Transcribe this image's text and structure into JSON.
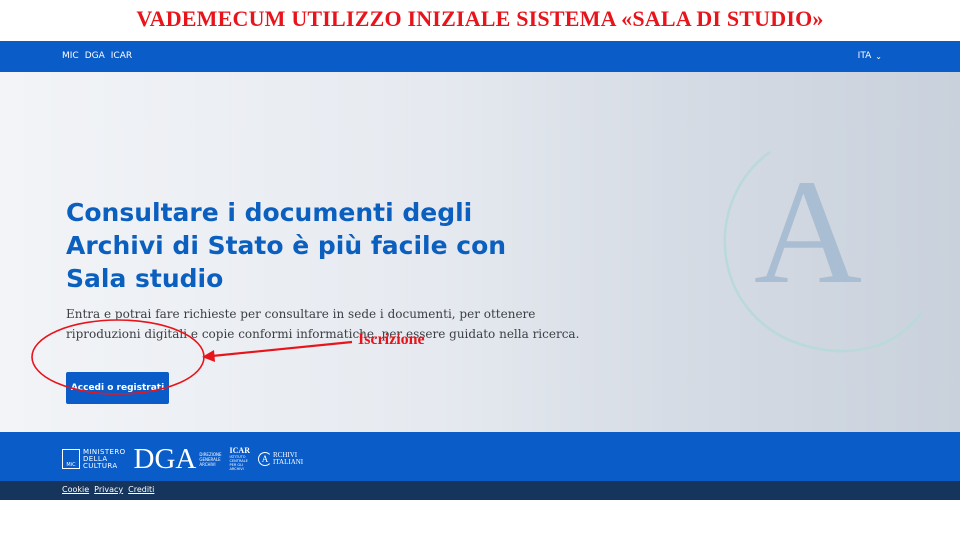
{
  "slide": {
    "title": "VADEMECUM UTILIZZO INIZIALE SISTEMA «SALA DI STUDIO»",
    "annotation_label": "Iscrizione"
  },
  "topbar": {
    "links": [
      "MIC",
      "DGA",
      "ICAR"
    ],
    "language": "ITA"
  },
  "hero": {
    "title": "Consultare i documenti degli Archivi di Stato è più facile con Sala studio",
    "description": "Entra e potrai fare richieste per consultare in sede i documenti, per ottenere riproduzioni digitali e copie conformi informatiche, per essere guidato nella ricerca.",
    "cta_label": "Accedi o registrati",
    "emblem_letter": "A"
  },
  "footer": {
    "mic": [
      "MINISTERO",
      "DELLA",
      "CULTURA"
    ],
    "mic_mark": "MiC",
    "dga": "DGA",
    "dga_sub": [
      "DIREZIONE",
      "GENERALE",
      "ARCHIVI"
    ],
    "icar": "ICAR",
    "icar_sub": [
      "ISTITUTO",
      "CENTRALE",
      "PER GLI",
      "ARCHIVI"
    ],
    "archivi": [
      "RCHIVI",
      "ITALIANI"
    ],
    "archivi_letter": "A",
    "links": [
      "Cookie",
      "Privacy",
      "Crediti"
    ]
  },
  "colors": {
    "brand_blue": "#0a5cc8",
    "dark_navy": "#16355c",
    "annotation_red": "#e8141c",
    "title_blue": "#0b5fbf"
  }
}
